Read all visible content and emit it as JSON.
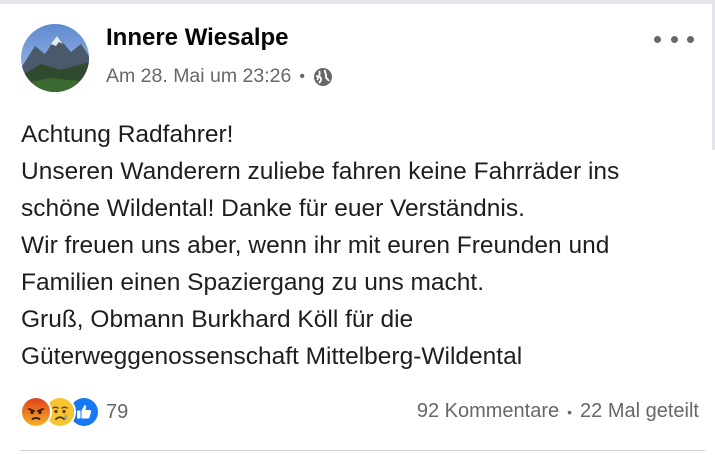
{
  "post": {
    "author": "Innere Wiesalpe",
    "timestamp": "Am 28. Mai um 23:26",
    "meta_separator": "•",
    "privacy_icon": "globe-icon",
    "menu_icon": "more-options-icon",
    "lines": [
      "Achtung Radfahrer!",
      "Unseren Wanderern zuliebe fahren keine Fahrräder ins",
      "schöne Wildental! Danke für euer Verständnis.",
      "Wir freuen uns aber, wenn ihr mit euren Freunden und",
      "Familien einen Spaziergang zu uns macht.",
      "Gruß, Obmann Burkhard Köll für die",
      "Güterweggenossenschaft Mittelberg-Wildental"
    ]
  },
  "reactions": {
    "icons": [
      "angry-reaction-icon",
      "sad-reaction-icon",
      "like-reaction-icon"
    ],
    "count": "79"
  },
  "engagement": {
    "comments": "92 Kommentare",
    "separator": "•",
    "shares": "22 Mal geteilt"
  },
  "colors": {
    "text": "#050505",
    "secondary": "#65676b",
    "like_blue": "#1877f2",
    "angry_orange": "#e9710f",
    "sad_yellow": "#f7b125"
  }
}
